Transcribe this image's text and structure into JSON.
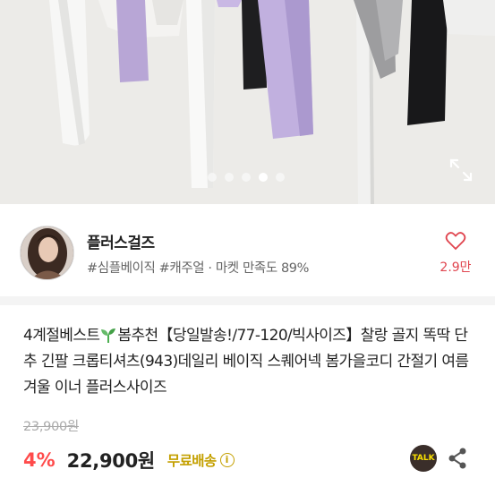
{
  "gallery": {
    "slide_count": 5,
    "active_index": 4,
    "expand_icon": "expand-icon"
  },
  "seller": {
    "name": "플러스걸즈",
    "tags": "#심플베이직 #캐주얼 · 마켓 만족도 89%",
    "likes": "2.9만",
    "like_icon": "heart-outline-icon"
  },
  "product": {
    "title_part1": "4계절베스트",
    "title_part2": "봄추천【당일발송!/77-120/빅사이즈】찰랑 골지 똑딱 단추 긴팔 크롭티셔츠(943)데일리 베이직 스퀘어넥 봄가을코디 간절기 여름 겨울 이너 플러스사이즈",
    "original_price": "23,900원",
    "discount": "4%",
    "price": "22,900원",
    "shipping": "무료배송",
    "info_icon": "i"
  },
  "actions": {
    "talk_label": "TALK",
    "share_icon": "share-icon"
  },
  "colors": {
    "discount": "#ff4b4b",
    "shipping": "#c4a000",
    "like": "#e0454f"
  }
}
